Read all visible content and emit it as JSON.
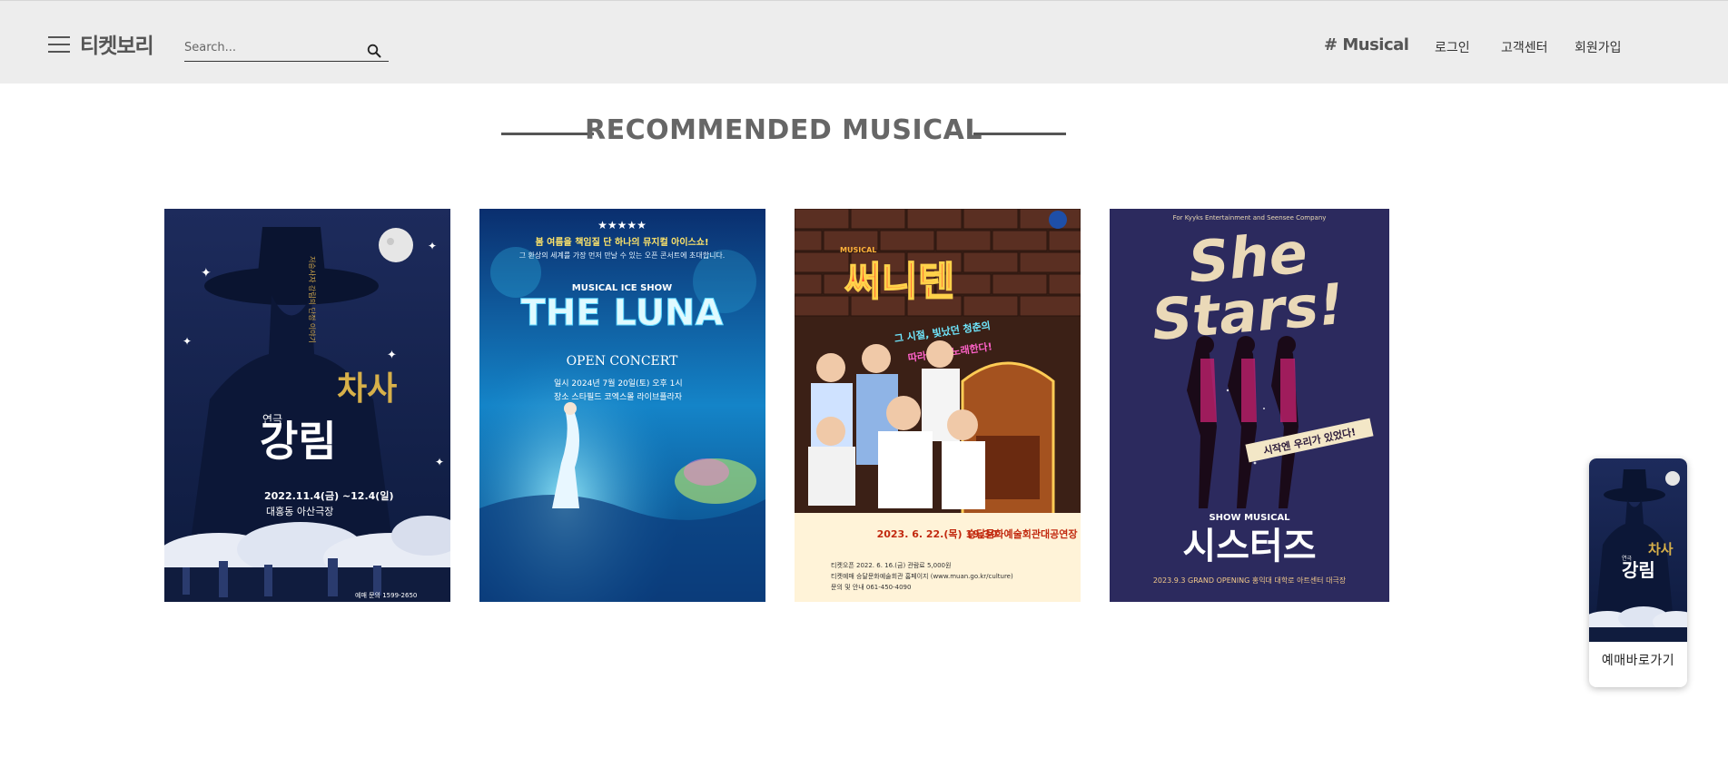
{
  "header": {
    "logo": "티켓보리",
    "search_placeholder": "Search...",
    "category_tag": "# Musical",
    "nav": {
      "login": "로그인",
      "support": "고객센터",
      "signup": "회원가입"
    }
  },
  "main": {
    "section_title": "RECOMMENDED MUSICAL",
    "posters": [
      {
        "label": "연극",
        "title": "차사",
        "subtitle": "강림",
        "date": "2022.11.4(금) ~12.4(일)",
        "venue": "대홍동 아산극장",
        "tagline": "저승사자 강림의 단정 이야기",
        "contact": "예매 문의 1599-2650"
      },
      {
        "headline": "봄 여름을 책임질 단 하나의 뮤지컬 아이스쇼!",
        "subhead": "그 환상의 세계를 가장 먼저 만날 수 있는 오픈 콘서트에 초대합니다.",
        "kicker": "MUSICAL ICE SHOW",
        "title": "THE LUNA",
        "concert": "OPEN CONCERT",
        "line1": "일시   2024년 7월 20일(토) 오후 1시",
        "line2": "장소   스타필드 코엑스몰 라이브플라자",
        "stars": "★★★★★"
      },
      {
        "musical": "MUSICAL",
        "title": "써니텐",
        "tag1": "그 시절, 빛났던 청춘의",
        "tag2": "따라 삶을 노래한다!",
        "date": "2023. 6. 22.(목) 19:30",
        "venue": "승달문화예술회관대공연장",
        "info1": "티켓오픈 2022. 6. 16.(금)   관람료 5,000원",
        "info2": "티켓예매 승달문화예술회관 홈페이지 (www.muan.go.kr/culture)",
        "info3": "문의 및 안내 061-450-4090"
      },
      {
        "presenter": "For Kyyks Entertainment and Seensee Company",
        "title_en1": "She",
        "title_en2": "Stars!",
        "slogan": "시작엔 우리가 있었다!",
        "kicker": "SHOW MUSICAL",
        "title_kr": "시스터즈",
        "opening": "2023.9.3 GRAND OPENING 홍익대 대학로 아트센터 대극장"
      }
    ]
  },
  "quick_booking": {
    "label": "예매바로가기",
    "thumb_label": "연극",
    "thumb_title": "차사",
    "thumb_subtitle": "강림"
  },
  "colors": {
    "header_bg": "#ededed",
    "title_color": "#666666",
    "poster1_bg": "#1b2750",
    "poster2_bg": "#0f4f8f",
    "poster3_bg": "#3a1f18",
    "poster4_bg": "#2a2755"
  }
}
